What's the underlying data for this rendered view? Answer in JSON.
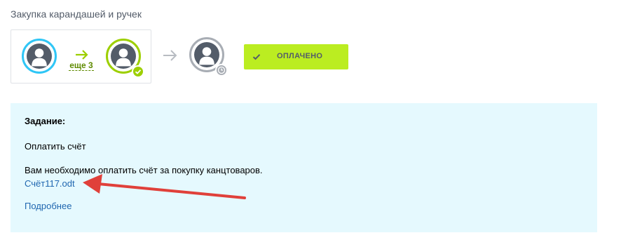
{
  "process": {
    "title": "Закупка карандашей и ручек",
    "more_label": "еще 3",
    "status_label": "ОПЛАЧЕНО"
  },
  "task": {
    "heading": "Задание:",
    "name": "Оплатить счёт",
    "description": "Вам необходимо оплатить счёт за покупку канцтоваров.",
    "file_link": "Счёт117.odt",
    "details_link": "Подробнее"
  },
  "colors": {
    "accent_green": "#bbed21",
    "avatar_border_active": "#2fc6f6",
    "avatar_border_done": "#9dcf00",
    "avatar_border_pending": "#a8adb4",
    "panel_bg": "#e5f9fe",
    "link": "#2067b0",
    "annotation_arrow": "#e0403a"
  },
  "icons": {
    "user": "user-silhouette-icon",
    "done": "check-icon",
    "pending": "clock-icon",
    "next": "arrow-right-icon",
    "status": "check-icon"
  }
}
